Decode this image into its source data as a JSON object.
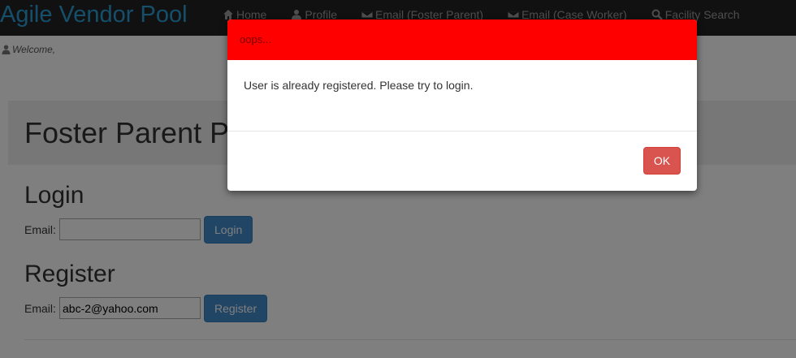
{
  "navbar": {
    "brand": "Agile Vendor Pool",
    "items": [
      {
        "label": "Home",
        "icon": "home-icon"
      },
      {
        "label": "Profile",
        "icon": "user-icon"
      },
      {
        "label": "Email (Foster Parent)",
        "icon": "envelope-icon"
      },
      {
        "label": "Email (Case Worker)",
        "icon": "envelope-icon"
      },
      {
        "label": "Facility Search",
        "icon": "search-icon"
      }
    ]
  },
  "welcome": {
    "text": "Welcome,",
    "icon": "user-icon"
  },
  "jumbotron": {
    "title": "Foster Parent P"
  },
  "login": {
    "title": "Login",
    "email_label": "Email:",
    "email_value": "",
    "button_label": "Login"
  },
  "register": {
    "title": "Register",
    "email_label": "Email:",
    "email_value": "abc-2@yahoo.com",
    "button_label": "Register"
  },
  "modal": {
    "title": "oops...",
    "message": "User is already registered. Please try to login.",
    "ok_label": "OK",
    "header_color": "#ff0000",
    "ok_color": "#d9534f"
  },
  "colors": {
    "brand": "#2a9fd6",
    "navbar_bg": "#222222",
    "primary": "#428bca"
  }
}
